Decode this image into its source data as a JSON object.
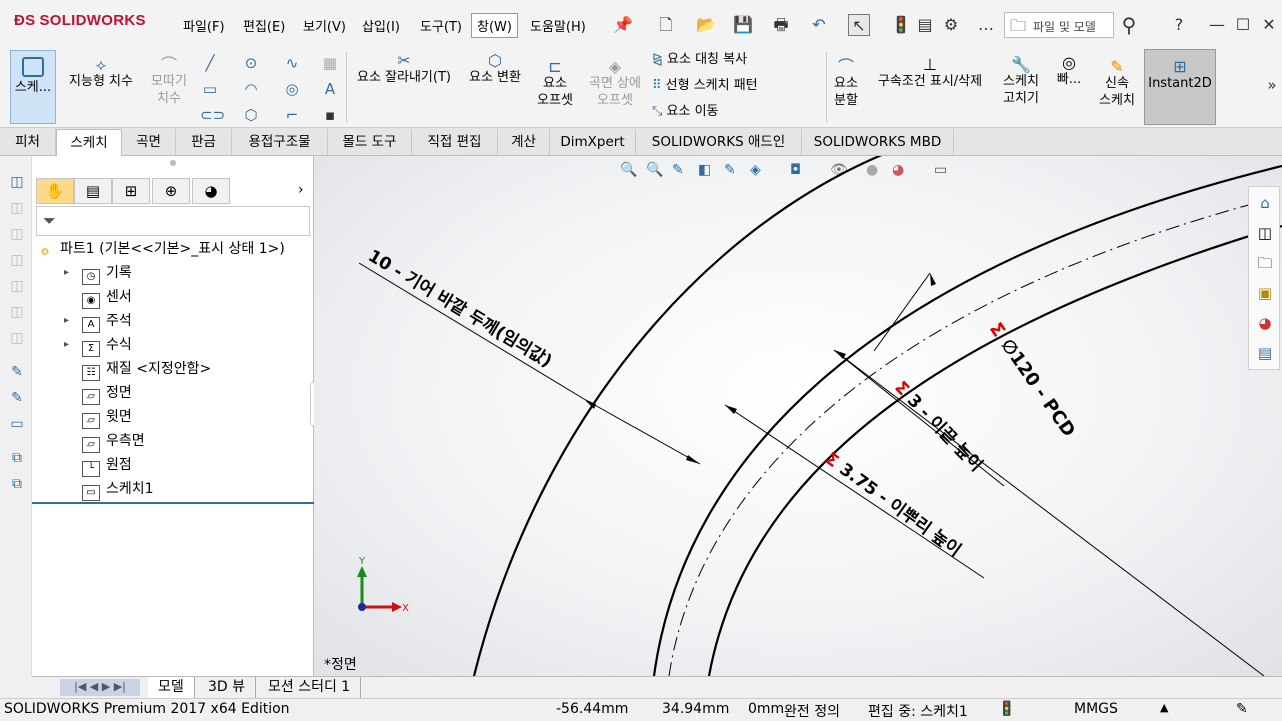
{
  "app": {
    "logo": "SOLIDWORKS"
  },
  "menu": [
    "파일(F)",
    "편집(E)",
    "보기(V)",
    "삽입(I)",
    "도구(T)",
    "창(W)",
    "도움말(H)"
  ],
  "search": {
    "placeholder": "파일 및 모델"
  },
  "help": "?",
  "ribbon": {
    "sketch": "스케...",
    "smart_dim": "지능형 치수",
    "fillet1": "모따기",
    "fillet2": "치수",
    "trim": "요소 잘라내기(T)",
    "convert": "요소 변환",
    "offset1": "요소",
    "offset2": "오프셋",
    "surf_offset1": "곡면 상에",
    "surf_offset2": "오프셋",
    "mirror": "요소 대칭 복사",
    "linear_pattern": "선형 스케치 패턴",
    "move": "요소 이동",
    "split1": "요소",
    "split2": "분할",
    "relations": "구속조건 표시/삭제",
    "repair1": "스케치",
    "repair2": "고치기",
    "quick": "빠...",
    "rapid1": "신속",
    "rapid2": "스케치",
    "instant2d": "Instant2D"
  },
  "tabs": [
    "피처",
    "스케치",
    "곡면",
    "판금",
    "용접구조물",
    "몰드 도구",
    "직접 편집",
    "계산",
    "DimXpert",
    "SOLIDWORKS 애드인",
    "SOLIDWORKS MBD"
  ],
  "active_tab": "스케치",
  "tree": {
    "root": "파트1 (기본<<기본>_표시 상태 1>)",
    "items": [
      {
        "label": "기록",
        "expandable": true,
        "icon": "history-icon"
      },
      {
        "label": "센서",
        "expandable": false,
        "icon": "sensor-icon"
      },
      {
        "label": "주석",
        "expandable": true,
        "icon": "annotation-icon"
      },
      {
        "label": "수식",
        "expandable": true,
        "icon": "equation-icon"
      },
      {
        "label": "재질 <지정안함>",
        "expandable": false,
        "icon": "material-icon"
      },
      {
        "label": "정면",
        "expandable": false,
        "icon": "plane-icon"
      },
      {
        "label": "윗면",
        "expandable": false,
        "icon": "plane-icon"
      },
      {
        "label": "우측면",
        "expandable": false,
        "icon": "plane-icon"
      },
      {
        "label": "원점",
        "expandable": false,
        "icon": "origin-icon"
      },
      {
        "label": "스케치1",
        "expandable": false,
        "icon": "sketch-icon"
      }
    ]
  },
  "drawing": {
    "dim_rim": "10 - 기어 바깥 두께(임의값)",
    "sigma": "Σ",
    "dim_pcd": "∅120 - PCD",
    "dim_addendum": "3 - 이끝 높이",
    "dim_dedendum": "3.75 - 이뿌리 높이",
    "axis_x": "X",
    "axis_y": "Y",
    "view_name": "*정면"
  },
  "bottom_tabs": [
    "모델",
    "3D 뷰",
    "모션 스터디 1"
  ],
  "status": {
    "edition": "SOLIDWORKS Premium 2017 x64 Edition",
    "x": "-56.44mm",
    "y": "34.94mm",
    "z": "0mm",
    "defined": "완전 정의",
    "editing": "편집 중: 스케치1",
    "units": "MMGS"
  },
  "colors": {
    "brand": "#c8102e",
    "sigma": "#e00000",
    "accent": "#2e6da4"
  }
}
